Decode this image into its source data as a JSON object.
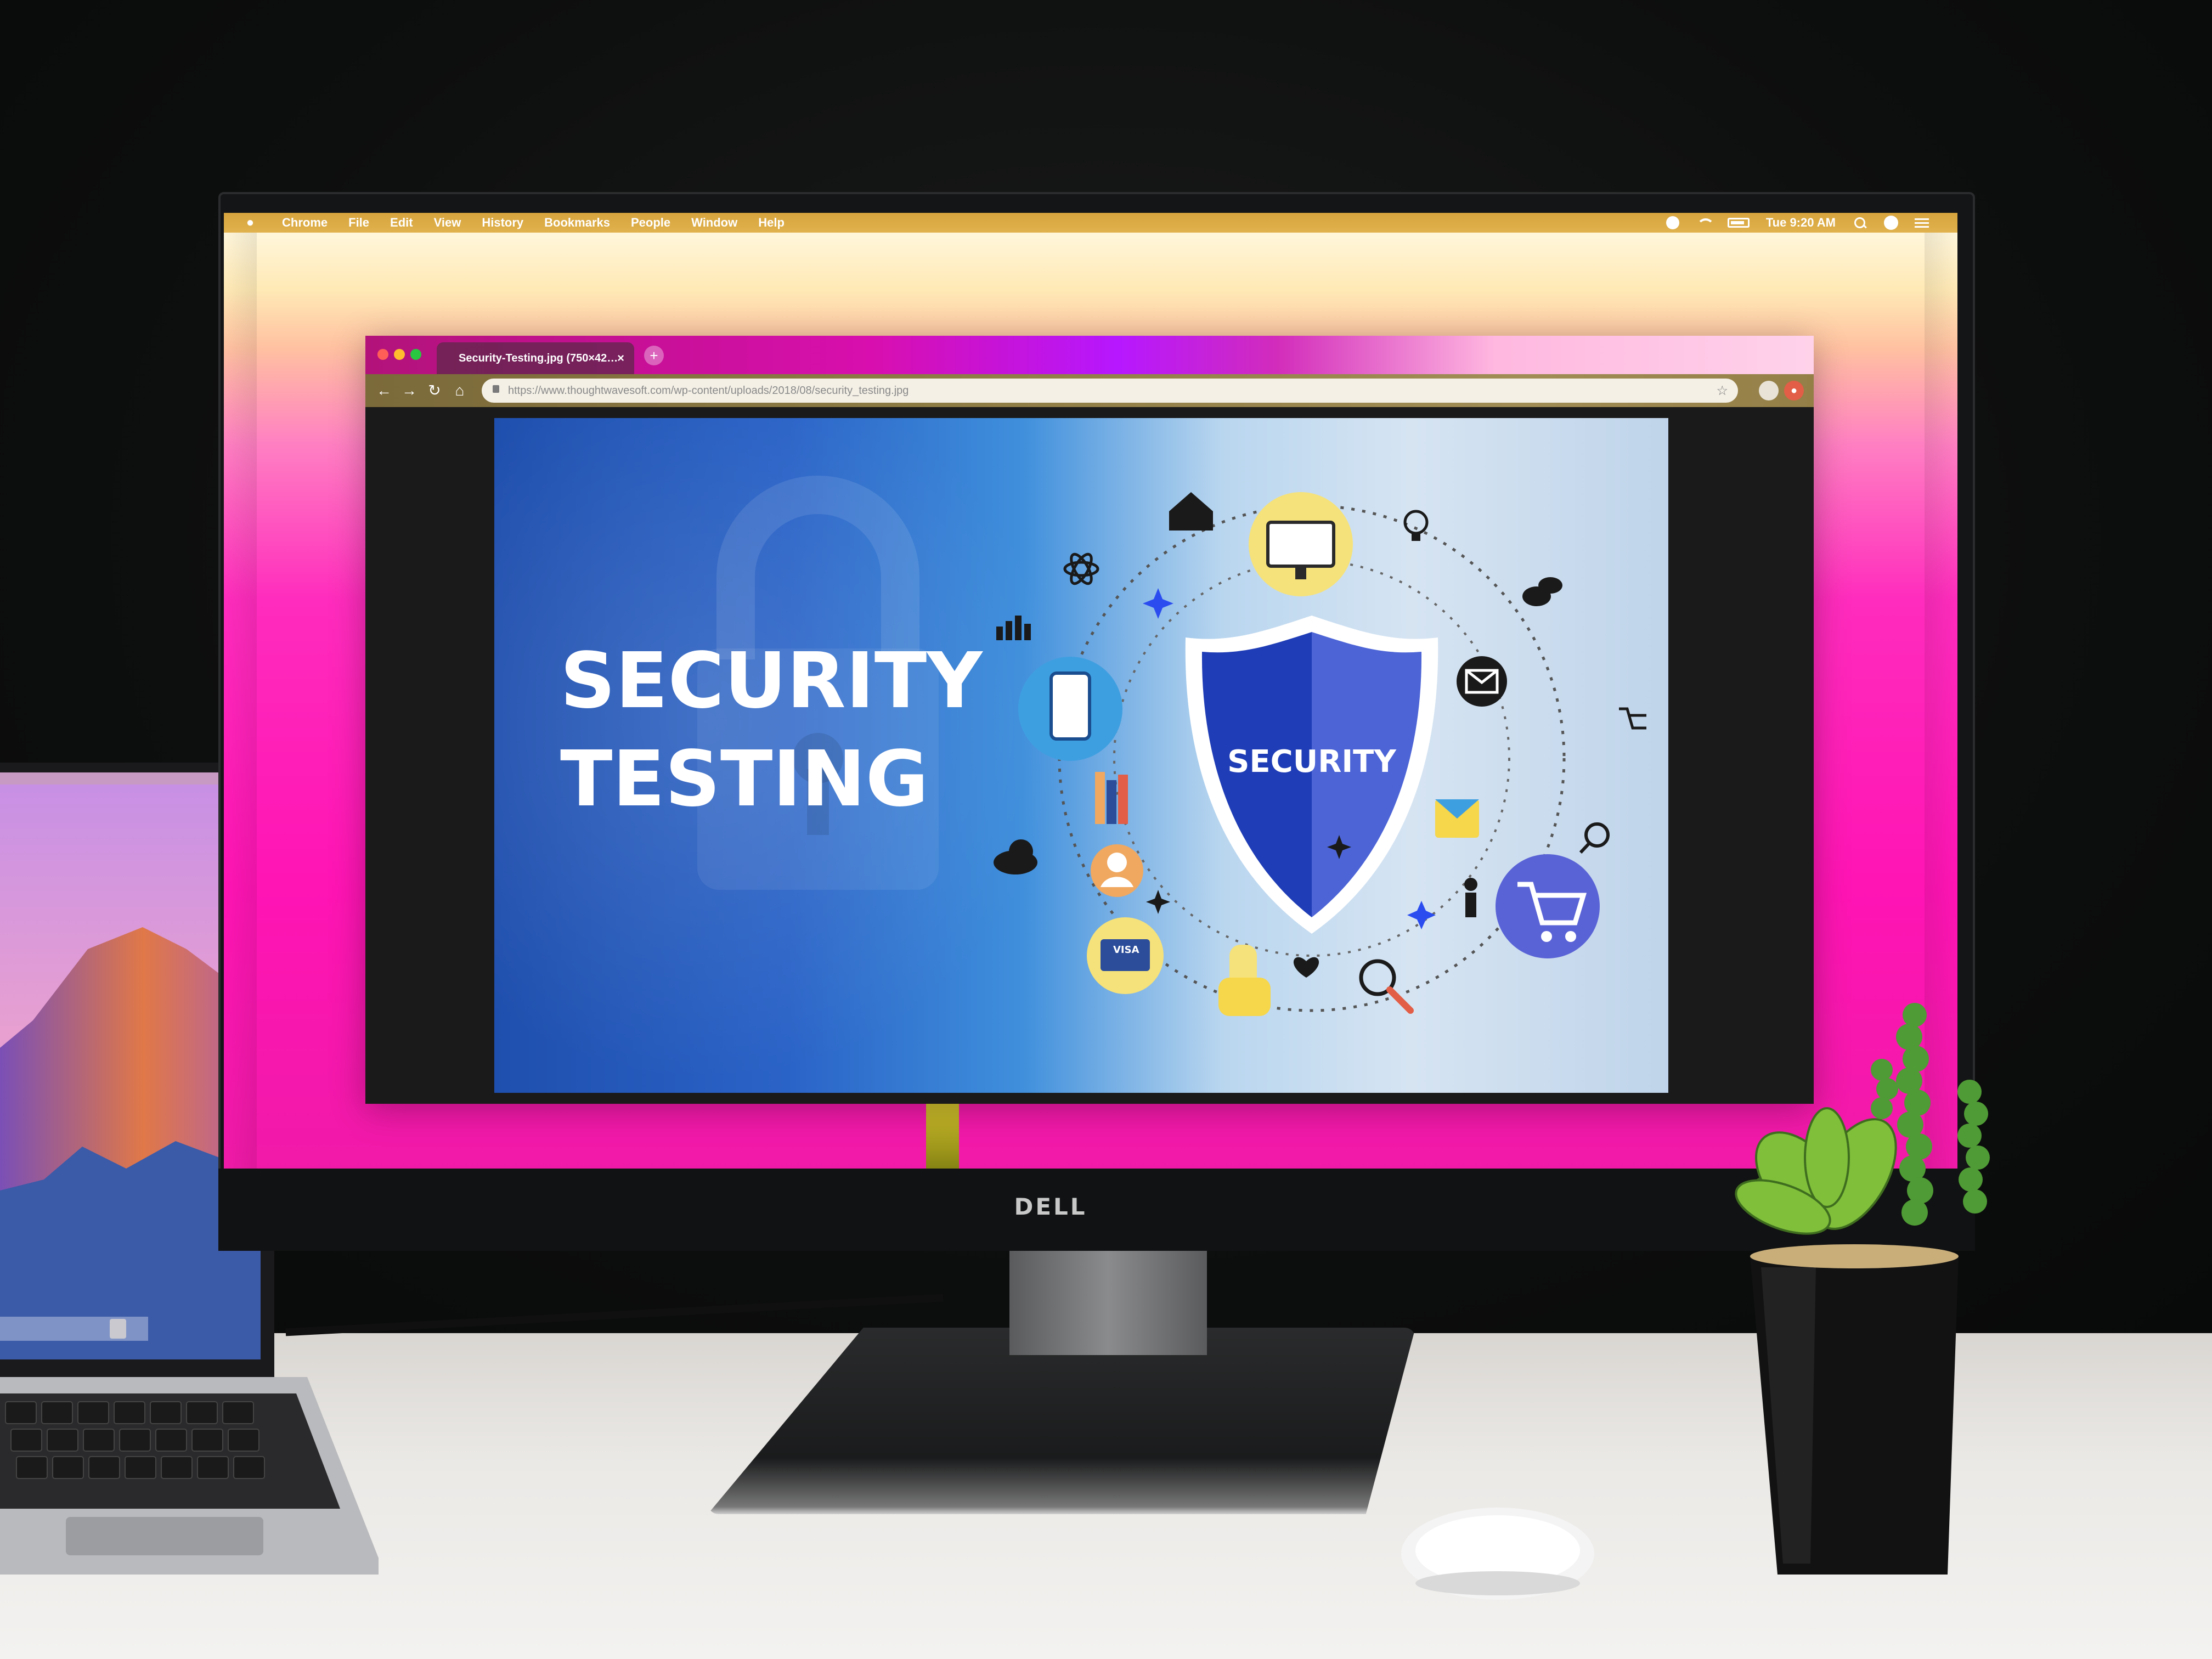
{
  "menubar": {
    "items": [
      "Chrome",
      "File",
      "Edit",
      "View",
      "History",
      "Bookmarks",
      "People",
      "Window",
      "Help"
    ],
    "clock": "Tue 9:20 AM"
  },
  "browser": {
    "tab_title": "Security-Testing.jpg (750×42…",
    "tab_close": "×",
    "new_tab": "+",
    "url": "https://www.thoughtwavesoft.com/wp-content/uploads/2018/08/security_testing.jpg"
  },
  "slide": {
    "title_line1": "SECURITY",
    "title_line2": "TESTING",
    "shield_label": "SECURITY",
    "card_text": "VISA"
  },
  "monitor": {
    "brand": "DELL"
  },
  "colors": {
    "shield_dark": "#1f3db6",
    "shield_light": "#4c64d6",
    "monitor_icon_bg": "#f6e27a",
    "tablet_icon_bg": "#3e9fe0",
    "cart_icon_bg": "#5a63d6"
  }
}
